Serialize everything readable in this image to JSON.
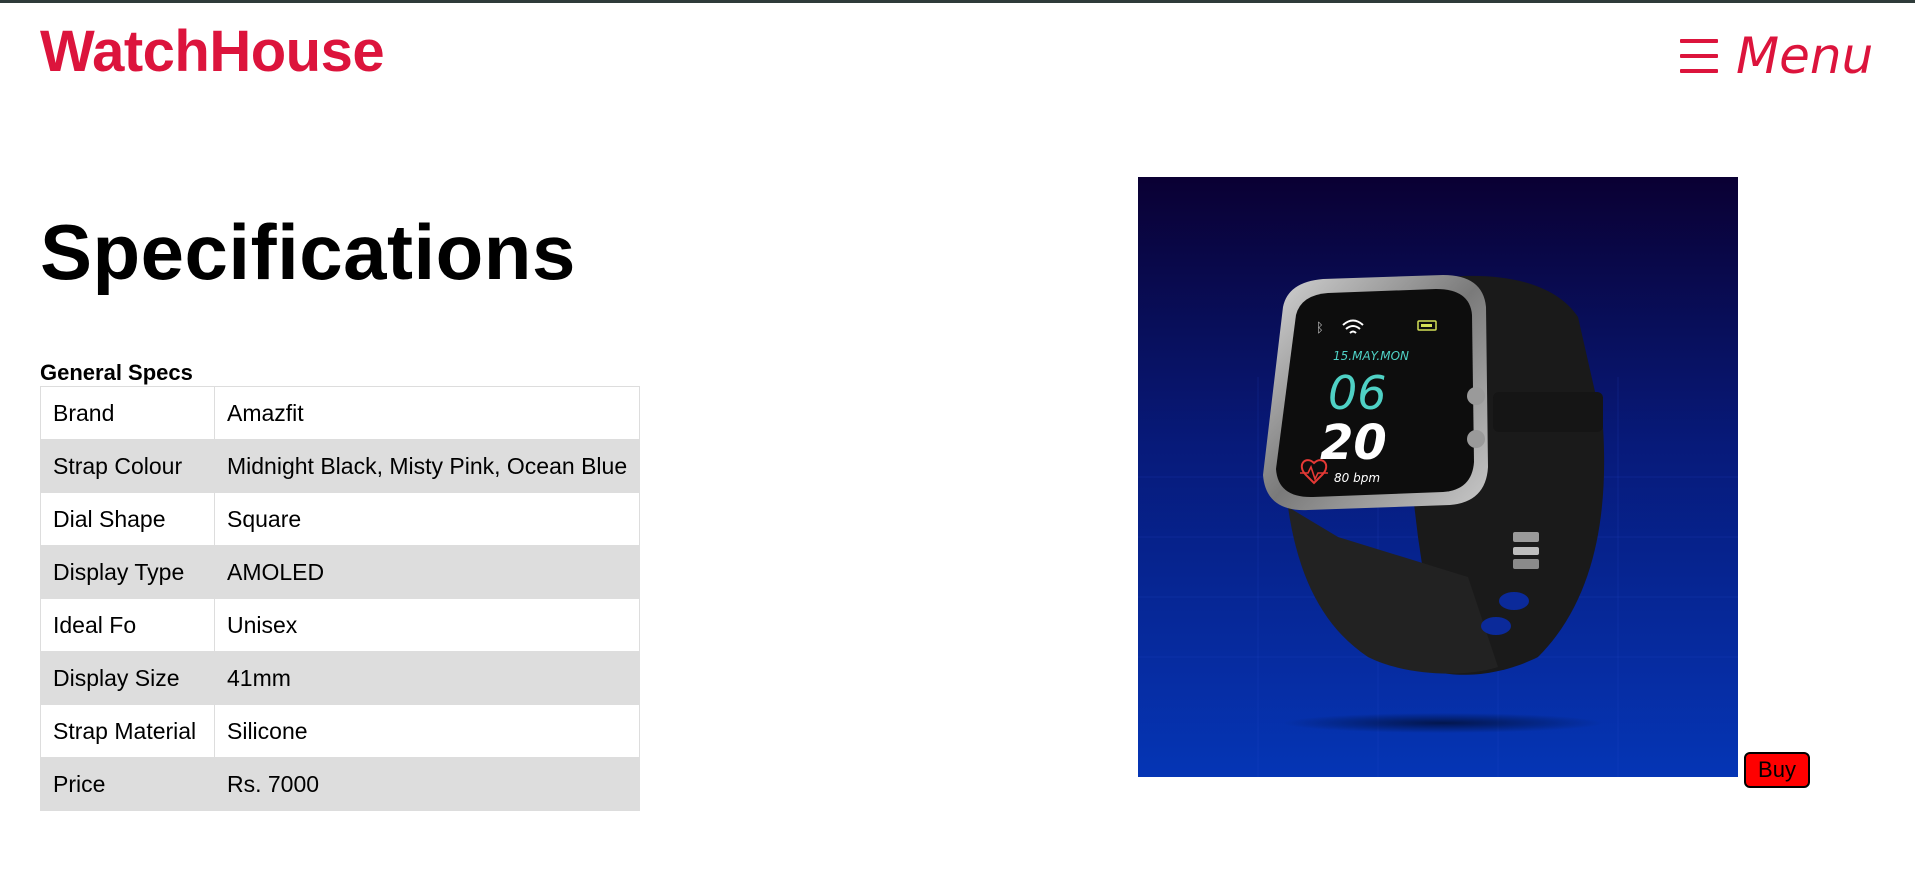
{
  "header": {
    "brand": "WatchHouse",
    "menu_label": "Menu"
  },
  "main": {
    "title": "Specifications",
    "specs_caption": "General Specs",
    "specs": [
      {
        "label": "Brand",
        "value": "Amazfit"
      },
      {
        "label": "Strap Colour",
        "value": "Midnight Black, Misty Pink, Ocean Blue"
      },
      {
        "label": "Dial Shape",
        "value": "Square"
      },
      {
        "label": "Display Type",
        "value": "AMOLED"
      },
      {
        "label": "Ideal Fo",
        "value": "Unisex"
      },
      {
        "label": "Display Size",
        "value": "41mm"
      },
      {
        "label": "Strap Material",
        "value": "Silicone"
      },
      {
        "label": "Price",
        "value": "Rs. 7000"
      }
    ],
    "buy_label": "Buy"
  },
  "watch_screen": {
    "date": "15.MAY.MON",
    "hour": "06",
    "minute": "20",
    "heart_rate": "80 bpm"
  },
  "colors": {
    "brand": "#dc143c",
    "buy_button": "#ff0000",
    "row_stripe": "#dddddd"
  }
}
